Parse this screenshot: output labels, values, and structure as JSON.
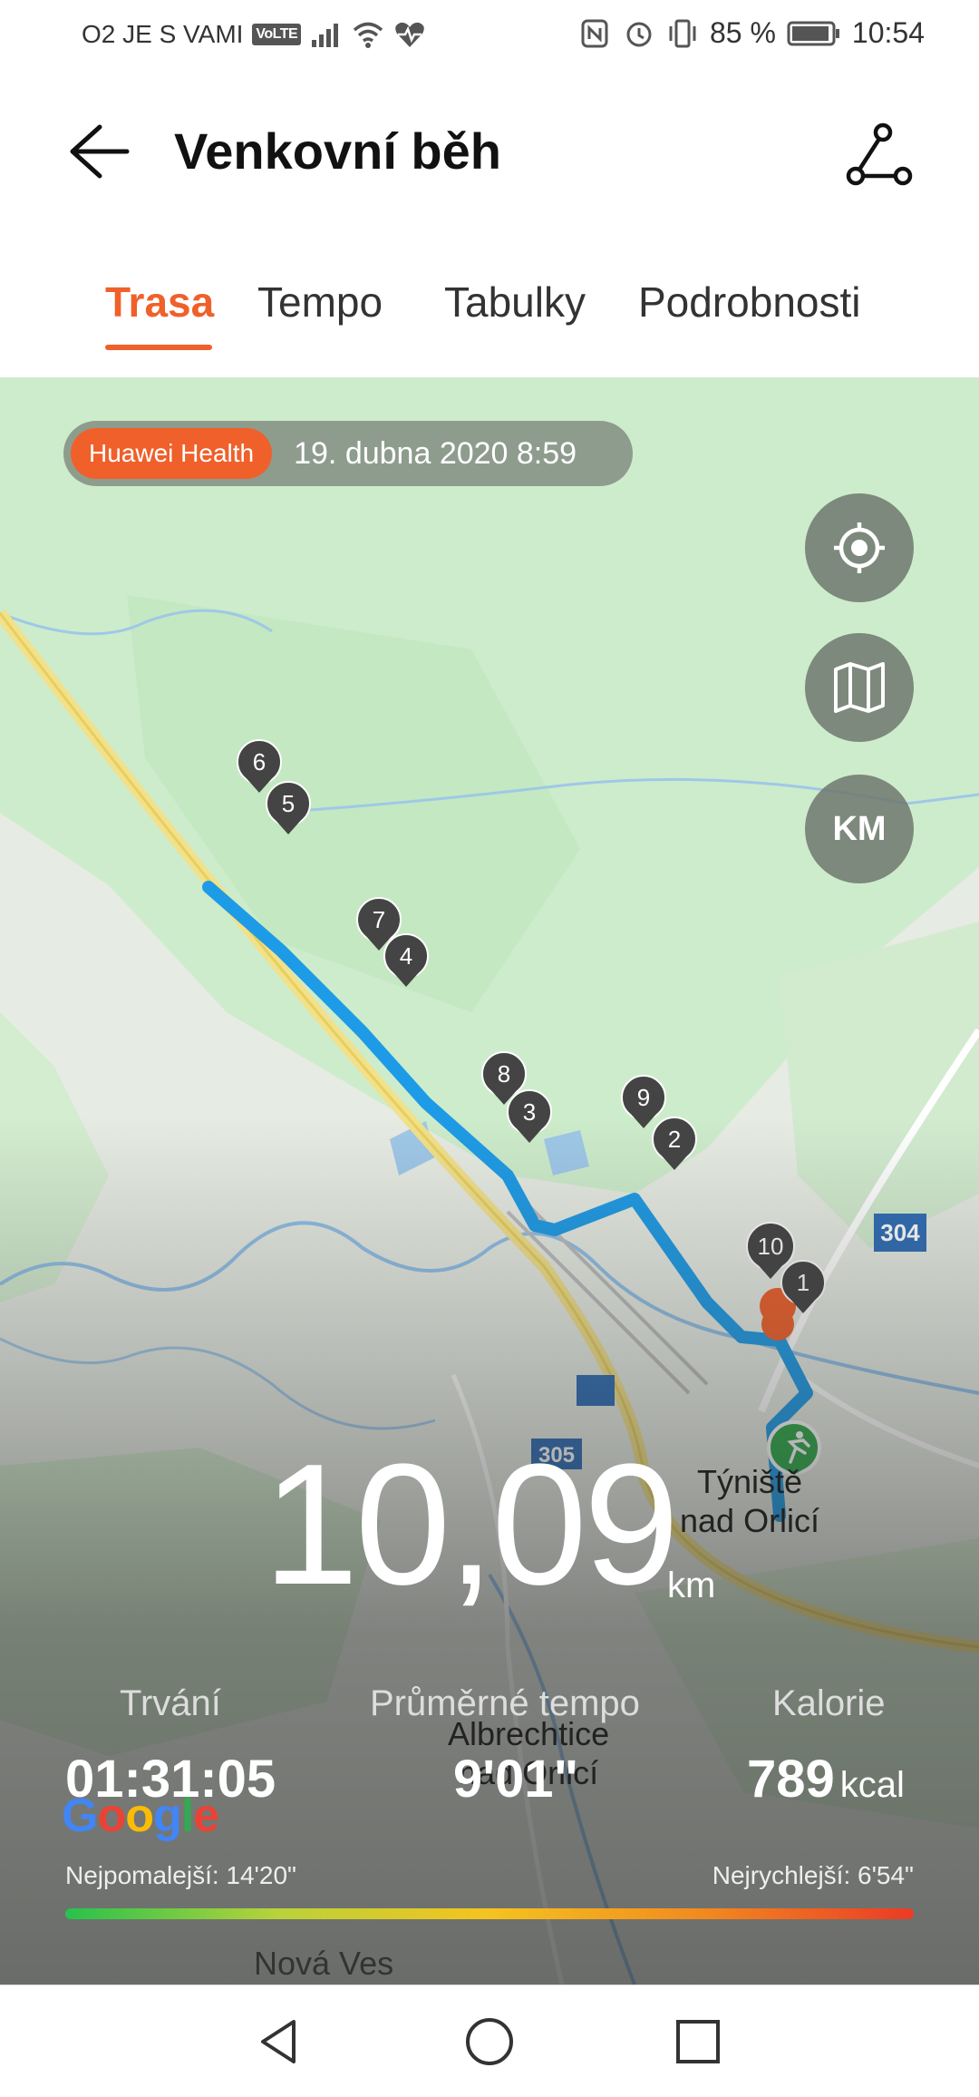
{
  "status_bar": {
    "carrier": "O2 JE S VAMI",
    "volte": "VoLTE",
    "battery": "85 %",
    "time": "10:54"
  },
  "header": {
    "title": "Venkovní běh"
  },
  "tabs": [
    {
      "label": "Trasa",
      "active": true
    },
    {
      "label": "Tempo",
      "active": false
    },
    {
      "label": "Tabulky",
      "active": false
    },
    {
      "label": "Podrobnosti",
      "active": false
    }
  ],
  "map": {
    "source_badge": "Huawei Health",
    "datetime": "19. dubna 2020 8:59",
    "unit_button": "KM",
    "road_label": "304",
    "road_label_2": "305",
    "town_1_line1": "Týniště",
    "town_1_line2": "nad Orlicí",
    "town_2_line1": "Albrechtice",
    "town_2_line2": "nad Orlicí",
    "town_3": "Nová Ves",
    "google_logo": "Google",
    "km_markers": [
      "1",
      "2",
      "3",
      "4",
      "5",
      "6",
      "7",
      "8",
      "9",
      "10"
    ]
  },
  "summary": {
    "distance": "10,09",
    "distance_unit": "km",
    "duration_label": "Trvání",
    "duration_value": "01:31:05",
    "pace_label": "Průměrné tempo",
    "pace_value": "9'01\"",
    "calories_label": "Kalorie",
    "calories_value": "789",
    "calories_unit": "kcal",
    "slowest_label": "Nejpomalejší: 14'20\"",
    "fastest_label": "Nejrychlejší: 6'54\""
  },
  "colors": {
    "accent": "#f0602a",
    "route": "#1e9be6",
    "start_marker": "#2fa84a"
  }
}
